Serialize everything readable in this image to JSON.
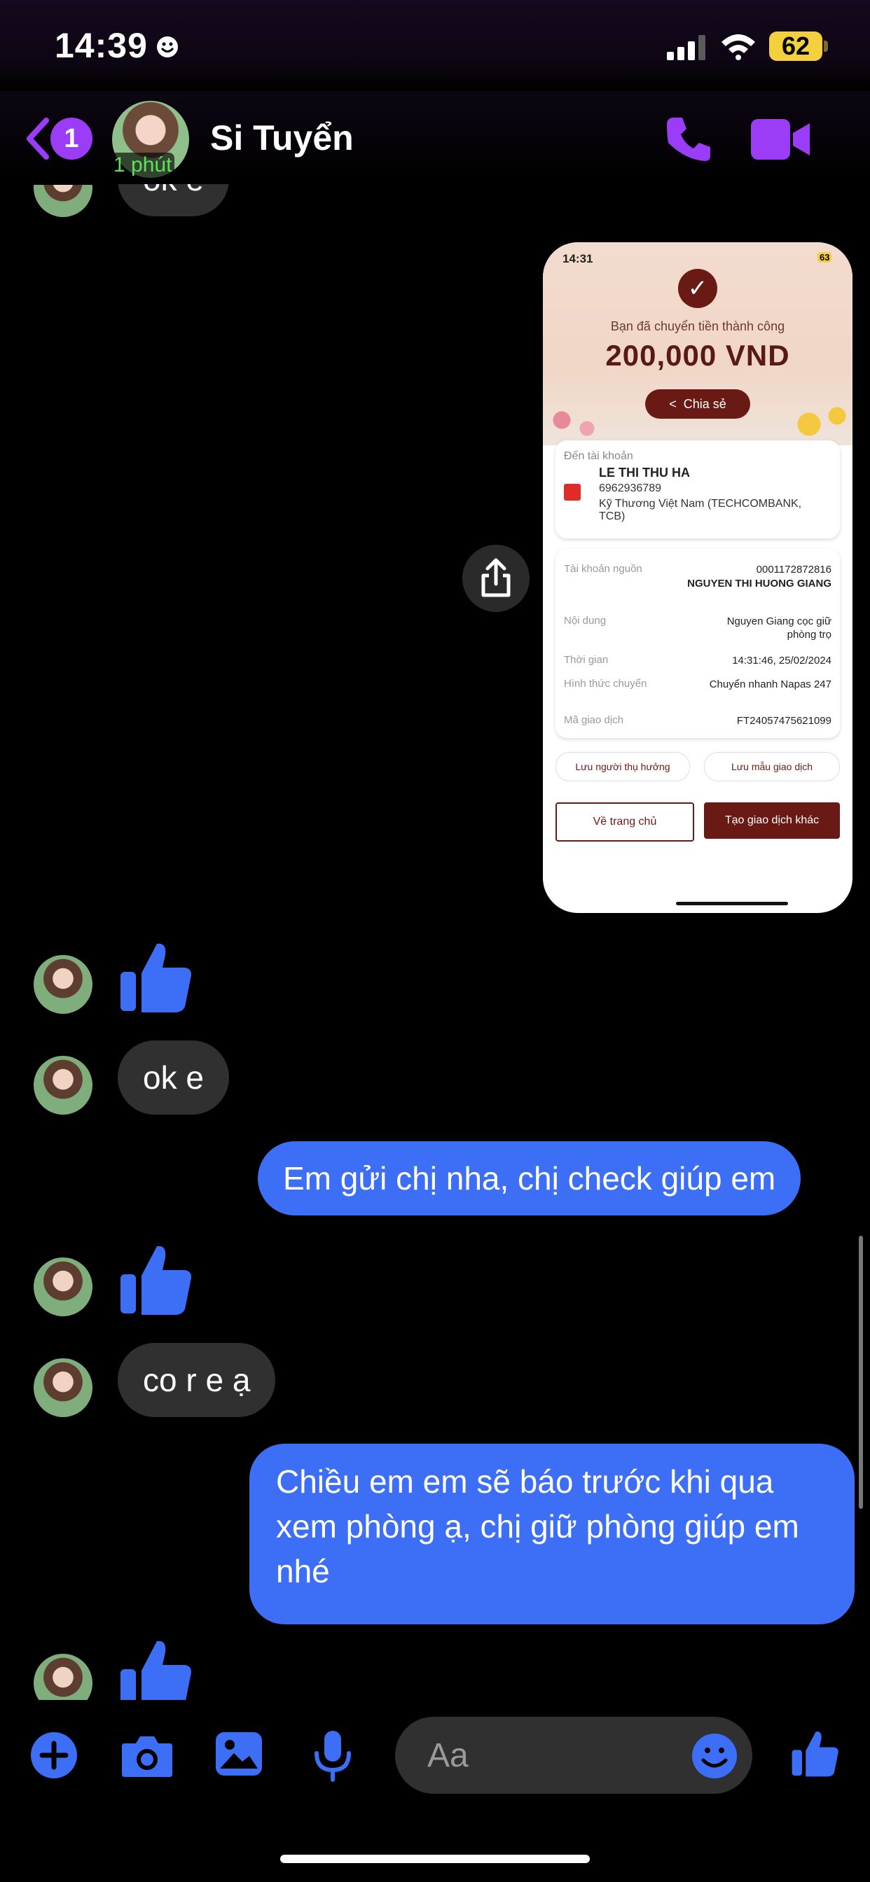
{
  "status_bar": {
    "time": "14:39",
    "battery": "62"
  },
  "header": {
    "unread_count": "1",
    "contact_name": "Si Tuyển",
    "active_ago": "1 phút"
  },
  "messages": {
    "partial_top": "ok e",
    "incoming_ok": "ok e",
    "outgoing_1": "Em gửi chị nha, chị check giúp em",
    "incoming_2": "co r e ạ",
    "outgoing_2": "Chiều em em sẽ báo trước khi qua xem phòng ạ, chị giữ phòng giúp em nhé"
  },
  "receipt": {
    "status_time": "14:31",
    "status_battery": "63",
    "success_text": "Bạn đã chuyển tiền thành công",
    "amount": "200,000 VND",
    "share_label": "Chia sẻ",
    "to_account_label": "Đến tài khoản",
    "recipient_name": "LE THI THU HA",
    "recipient_account": "6962936789",
    "recipient_bank": "Kỹ Thương Việt Nam (TECHCOMBANK, TCB)",
    "source_label": "Tài khoản nguồn",
    "source_value": "0001172872816",
    "source_name": "NGUYEN THI HUONG GIANG",
    "content_label": "Nội dung",
    "content_value": "Nguyen Giang cọc giữ phòng trọ",
    "time_label": "Thời gian",
    "time_value": "14:31:46, 25/02/2024",
    "method_label": "Hình thức chuyển",
    "method_value": "Chuyển nhanh Napas 247",
    "txn_label": "Mã giao dịch",
    "txn_value": "FT24057475621099",
    "save_recipient": "Lưu người thụ hưởng",
    "save_template": "Lưu mẫu giao dịch",
    "home_button": "Về trang chủ",
    "new_txn_button": "Tạo giao dịch khác"
  },
  "composer": {
    "placeholder": "Aa"
  },
  "colors": {
    "accent": "#3d6ef6",
    "purple": "#9b3cf6",
    "receipt_brand": "#6a1a14"
  }
}
